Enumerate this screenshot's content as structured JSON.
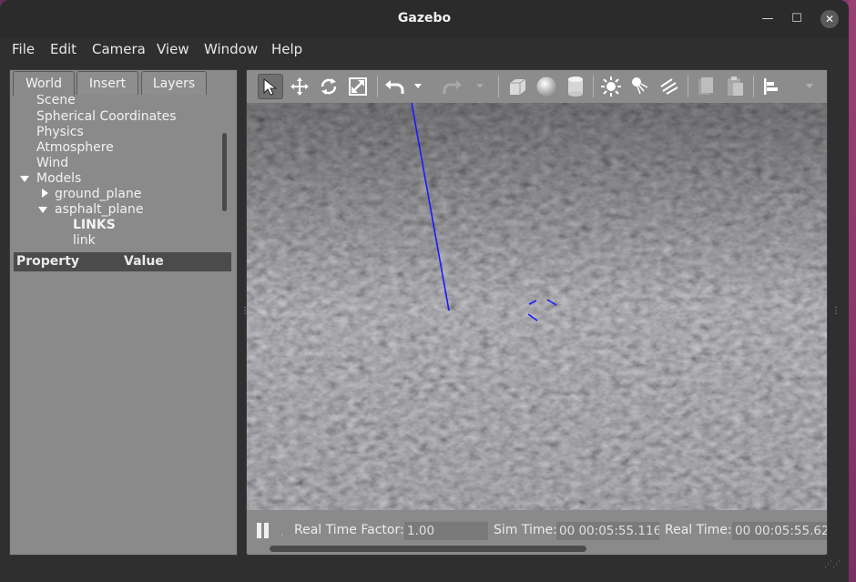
{
  "window": {
    "title": "Gazebo"
  },
  "titlebar_buttons": {
    "minimize": "—",
    "maximize": "☐",
    "close": "✕"
  },
  "menu": {
    "file": "File",
    "edit": "Edit",
    "camera": "Camera",
    "view": "View",
    "window": "Window",
    "help": "Help"
  },
  "left_tabs": {
    "world": "World",
    "insert": "Insert",
    "layers": "Layers"
  },
  "tree": {
    "scene": "Scene",
    "spherical": "Spherical Coordinates",
    "physics": "Physics",
    "atmosphere": "Atmosphere",
    "wind": "Wind",
    "models": "Models",
    "ground_plane": "ground_plane",
    "asphalt_plane": "asphalt_plane",
    "links": "LINKS",
    "link": "link"
  },
  "properties": {
    "property_col": "Property",
    "value_col": "Value"
  },
  "toolbar": {
    "icons": [
      "select-arrow-icon",
      "translate-icon",
      "rotate-icon",
      "scale-icon",
      "undo-icon",
      "undo-dropdown-icon",
      "redo-icon",
      "redo-dropdown-icon",
      "box-icon",
      "sphere-icon",
      "cylinder-icon",
      "point-light-icon",
      "spot-light-icon",
      "directional-light-icon",
      "copy-icon",
      "paste-icon",
      "align-icon",
      "more-dropdown-icon"
    ]
  },
  "status": {
    "rtf_label": "Real Time Factor:",
    "rtf_value": "1.00",
    "sim_label": "Sim Time:",
    "sim_value": "00 00:05:55.116",
    "real_label": "Real Time:",
    "real_value": "00 00:05:55.62"
  },
  "colors": {
    "accent": "#1a1aff",
    "window_bg": "#2f2f2f",
    "panel_bg": "#8a8a8a",
    "desktop": "#8a3a6a"
  }
}
